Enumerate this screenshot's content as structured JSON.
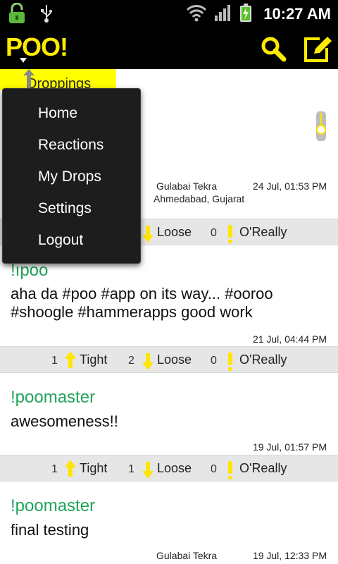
{
  "status_bar": {
    "time": "10:27 AM",
    "icons": [
      "lock-icon",
      "usb-icon",
      "wifi-icon",
      "signal-icon",
      "battery-charging-icon"
    ]
  },
  "action_bar": {
    "logo": "POO!",
    "icons": [
      "search-icon",
      "compose-icon"
    ],
    "accent_color": "#ffeb00"
  },
  "tab": {
    "label": "Droppings"
  },
  "menu": {
    "items": [
      "Home",
      "Reactions",
      "My Drops",
      "Settings",
      "Logout"
    ]
  },
  "posts": [
    {
      "username": "",
      "text": "",
      "location_line1": "Gulabai Tekra",
      "location_line2": "Ahmedabad, Gujarat",
      "date": "24 Jul, 01:53 PM",
      "reactions": {
        "tight": "",
        "loose": "",
        "oreally": "0"
      },
      "labels": {
        "tight": "",
        "loose": "Loose",
        "oreally": "O'Really"
      }
    },
    {
      "username": "!ıpoo",
      "text": "aha da #poo #app on its way... #ooroo #shoogle #hammerapps good work",
      "date": "21 Jul, 04:44 PM",
      "reactions": {
        "tight": "1",
        "loose": "2",
        "oreally": "0"
      },
      "labels": {
        "tight": "Tight",
        "loose": "Loose",
        "oreally": "O'Really"
      }
    },
    {
      "username": "!poomaster",
      "text": "awesomeness!!",
      "date": "19 Jul, 01:57 PM",
      "reactions": {
        "tight": "1",
        "loose": "1",
        "oreally": "0"
      },
      "labels": {
        "tight": "Tight",
        "loose": "Loose",
        "oreally": "O'Really"
      }
    },
    {
      "username": "!poomaster",
      "text": "final testing",
      "location_line1": "Gulabai Tekra",
      "date": "19 Jul, 12:33 PM"
    }
  ],
  "colors": {
    "username": "#21a35a",
    "arrow_yellow": "#ffe600",
    "reaction_bar": "#e6e6e6",
    "menu_bg": "#1d1d1d"
  }
}
